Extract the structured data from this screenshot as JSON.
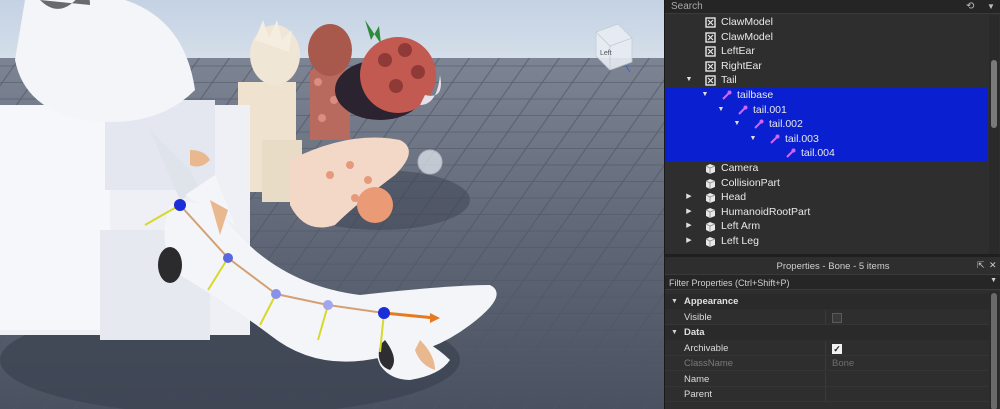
{
  "viewport": {
    "view_cube_label": "Left"
  },
  "explorer": {
    "search_placeholder": "Search",
    "history_icon": "history-icon",
    "expand_icon": "chevron-down-icon",
    "items": [
      {
        "label": "ClawModel",
        "icon": "model-icon",
        "expanded": null,
        "selected": false
      },
      {
        "label": "ClawModel",
        "icon": "model-icon",
        "expanded": null,
        "selected": false
      },
      {
        "label": "LeftEar",
        "icon": "model-icon",
        "expanded": null,
        "selected": false
      },
      {
        "label": "RightEar",
        "icon": "model-icon",
        "expanded": null,
        "selected": false
      },
      {
        "label": "Tail",
        "icon": "model-icon",
        "expanded": true,
        "selected": false
      },
      {
        "label": "tailbase",
        "icon": "bone-icon",
        "expanded": true,
        "selected": true
      },
      {
        "label": "tail.001",
        "icon": "bone-icon",
        "expanded": true,
        "selected": true
      },
      {
        "label": "tail.002",
        "icon": "bone-icon",
        "expanded": true,
        "selected": true
      },
      {
        "label": "tail.003",
        "icon": "bone-icon",
        "expanded": true,
        "selected": true
      },
      {
        "label": "tail.004",
        "icon": "bone-icon",
        "expanded": null,
        "selected": true
      },
      {
        "label": "Camera",
        "icon": "part-icon",
        "expanded": null,
        "selected": false
      },
      {
        "label": "CollisionPart",
        "icon": "part-icon",
        "expanded": null,
        "selected": false
      },
      {
        "label": "Head",
        "icon": "part-icon",
        "expanded": false,
        "selected": false
      },
      {
        "label": "HumanoidRootPart",
        "icon": "part-icon",
        "expanded": false,
        "selected": false
      },
      {
        "label": "Left Arm",
        "icon": "part-icon",
        "expanded": false,
        "selected": false
      },
      {
        "label": "Left Leg",
        "icon": "part-icon",
        "expanded": false,
        "selected": false
      }
    ]
  },
  "properties": {
    "title": "Properties - Bone - 5 items",
    "filter_placeholder": "Filter Properties (Ctrl+Shift+P)",
    "rows": [
      {
        "kind": "category",
        "label": "Appearance"
      },
      {
        "kind": "prop",
        "name": "Visible",
        "control": "checkbox",
        "checked": false,
        "dim": false,
        "value": ""
      },
      {
        "kind": "category",
        "label": "Data"
      },
      {
        "kind": "prop",
        "name": "Archivable",
        "control": "checkbox",
        "checked": true,
        "dim": false,
        "value": ""
      },
      {
        "kind": "prop",
        "name": "ClassName",
        "control": "text",
        "checked": false,
        "dim": true,
        "value": "Bone"
      },
      {
        "kind": "prop",
        "name": "Name",
        "control": "text",
        "checked": false,
        "dim": false,
        "value": ""
      },
      {
        "kind": "prop",
        "name": "Parent",
        "control": "text",
        "checked": false,
        "dim": false,
        "value": ""
      }
    ]
  },
  "colors": {
    "selection": "#0a1fcf",
    "bone_icon": "#d066ff",
    "panel_bg": "#2e2e2e",
    "sky": "#c9d6e6",
    "floor": "#5a6270"
  }
}
